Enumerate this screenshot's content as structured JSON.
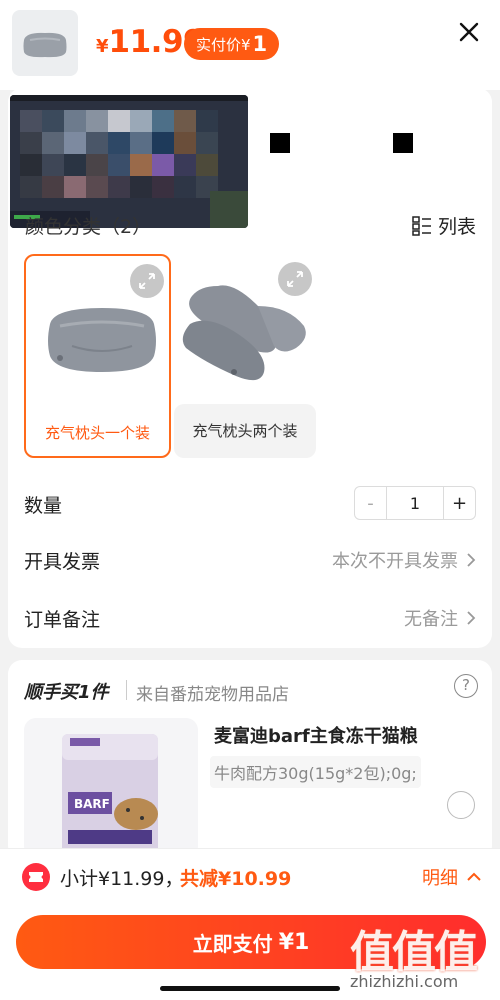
{
  "header": {
    "price_symbol": "¥",
    "price": "11.99",
    "badge_label": "实付价¥",
    "badge_amount": "1"
  },
  "spec": {
    "section_title": "颜色分类（2）",
    "list_label": "列表",
    "options": [
      {
        "label": "充气枕头一个装",
        "selected": true
      },
      {
        "label": "充气枕头两个装",
        "selected": false
      }
    ]
  },
  "rows": {
    "quantity_label": "数量",
    "quantity_minus": "-",
    "quantity_value": "1",
    "quantity_plus": "+",
    "invoice_label": "开具发票",
    "invoice_value": "本次不开具发票",
    "remark_label": "订单备注",
    "remark_value": "无备注"
  },
  "addon": {
    "title": "顺手买1件",
    "from": "来自番茄宠物用品店",
    "help": "?",
    "product_name": "麦富迪barf主食冻干猫粮",
    "product_spec": "牛肉配方30g(15g*2包);0g;",
    "package_text": "BARF"
  },
  "footer": {
    "subtotal": "小计¥11.99，",
    "discount": "共减¥10.99",
    "detail": "明细",
    "pay_label": "立即支付",
    "pay_amount": "¥1",
    "watermark_logo": "值值值",
    "watermark_url": "zhizhizhi.com"
  },
  "colors": {
    "accent": "#ff5a12",
    "accent_red": "#ff2d2d"
  }
}
